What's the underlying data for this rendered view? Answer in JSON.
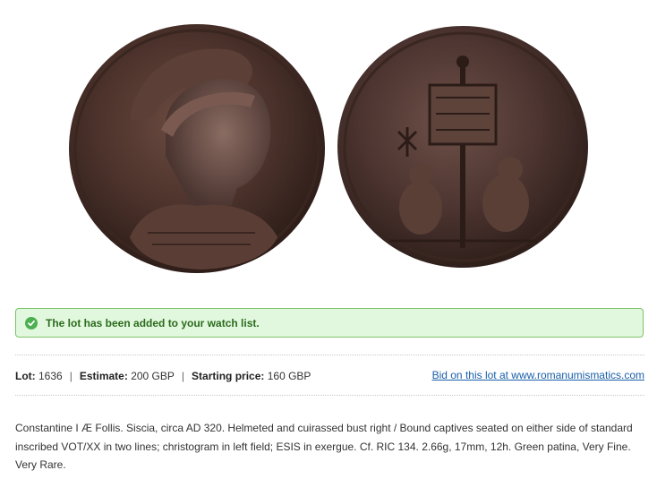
{
  "images": {
    "obverse_alt": "",
    "reverse_alt": ""
  },
  "notice": {
    "message": "The lot has been added to your watch list.",
    "icon": "check-circle-icon",
    "color": "#4caf50"
  },
  "lot_info": {
    "lot_label": "Lot:",
    "lot_value": "1636",
    "estimate_label": "Estimate:",
    "estimate_value": "200 GBP",
    "starting_label": "Starting price:",
    "starting_value": "160 GBP",
    "separator": "|",
    "bid_link": "Bid on this lot at www.romanumismatics.com"
  },
  "description": "Constantine I Æ Follis. Siscia, circa AD 320. Helmeted and cuirassed bust right / Bound captives seated on either side of standard inscribed VOT/XX in two lines; christogram in left field; ESIS in exergue. Cf. RIC 134. 2.66g, 17mm, 12h. Green patina, Very Fine. Very Rare."
}
